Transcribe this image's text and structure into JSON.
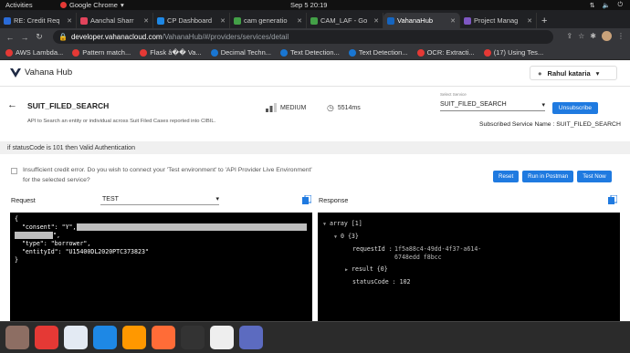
{
  "os": {
    "activities": "Activities",
    "app_name": "Google Chrome",
    "clock": "Sep 5  20:19"
  },
  "tabs": [
    {
      "label": "RE: Credit Req",
      "color": "#2a6bd8"
    },
    {
      "label": "Aanchal Sharr",
      "color": "#e2445c"
    },
    {
      "label": "CP Dashboard",
      "color": "#1e88e5"
    },
    {
      "label": "cam generatio",
      "color": "#43a047"
    },
    {
      "label": "CAM_LAF - Go",
      "color": "#43a047"
    },
    {
      "label": "VahanaHub",
      "color": "#1565c0",
      "active": true
    },
    {
      "label": "Project Manag",
      "color": "#7e57c2"
    }
  ],
  "address_bar": {
    "host": "developer.vahanacloud.com",
    "path": "/VahanaHub/#/providers/services/detail"
  },
  "bookmarks": [
    {
      "label": "AWS Lambda...",
      "color": "#e53935"
    },
    {
      "label": "Pattern match...",
      "color": "#e53935"
    },
    {
      "label": "Flask â�� Va...",
      "color": "#e53935"
    },
    {
      "label": "Decimal Techn...",
      "color": "#1976d2"
    },
    {
      "label": "Text Detection...",
      "color": "#1976d2"
    },
    {
      "label": "Text Detection...",
      "color": "#1976d2"
    },
    {
      "label": "OCR: Extracti...",
      "color": "#e53935"
    },
    {
      "label": "(17) Using Tes...",
      "color": "#e53935"
    }
  ],
  "header": {
    "logo": "Vahana Hub",
    "user": "Rahul kataria"
  },
  "service": {
    "name": "SUIT_FILED_SEARCH",
    "description": "API to Search an entity or individual across Suit Filed Cases reported into CIBIL.",
    "tier": "MEDIUM",
    "latency": "5514ms",
    "select_label": "Select Service",
    "selected": "SUIT_FILED_SEARCH",
    "unsubscribe_label": "Unsubscribe",
    "subscribed_text": "Subscribed Service Name : SUIT_FILED_SEARCH"
  },
  "status_note": "if statusCode is 101 then Valid Authentication",
  "warning": "Insufficient credit error. Do you wish to connect your 'Test environment' to 'API Provider Live Environment' for the selected service?",
  "actions": {
    "reset": "Reset",
    "run": "Run in Postman",
    "test": "Test Now"
  },
  "request": {
    "label": "Request",
    "environment": "TEST",
    "line1": "{",
    "consent_key": "  \"consent\": \"Y\",",
    "type_line": "  \"type\": \"borrower\",",
    "entity_line": "  \"entityId\": \"U15400DL2020PTC373823\"",
    "close": "}"
  },
  "response": {
    "label": "Response",
    "root": "array [1]",
    "item": "0 {3}",
    "requestId_key": "requestId :",
    "requestId_val1": "1f5a88c4-49dd-4f37-a614-",
    "requestId_val2": "6748edd f8bcc",
    "result": "result {0}",
    "statusCode": "statusCode : 102"
  },
  "dock": [
    {
      "name": "files",
      "color": "#8d6e63"
    },
    {
      "name": "chrome",
      "color": "#e53935"
    },
    {
      "name": "text-editor",
      "color": "#e3eaf3"
    },
    {
      "name": "vscode",
      "color": "#1e88e5"
    },
    {
      "name": "vlc",
      "color": "#ff9800"
    },
    {
      "name": "postman",
      "color": "#ff6c37"
    },
    {
      "name": "terminal",
      "color": "#333333"
    },
    {
      "name": "inkscape",
      "color": "#eeeeee"
    },
    {
      "name": "screenshot",
      "color": "#5c6bc0"
    }
  ]
}
